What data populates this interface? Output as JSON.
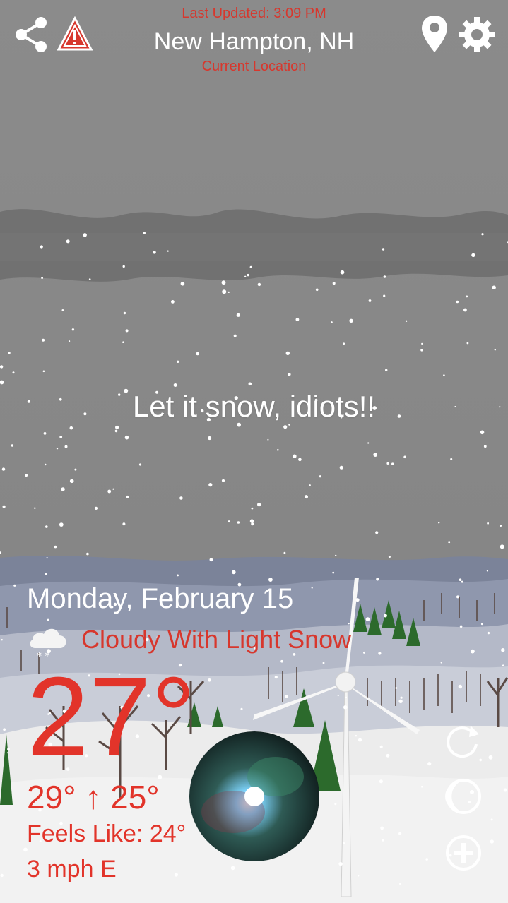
{
  "header": {
    "last_updated": "Last Updated: 3:09 PM",
    "location": "New Hampton, NH",
    "location_sub": "Current Location"
  },
  "message": "Let it snow, idiots!!",
  "weather": {
    "date": "Monday, February 15",
    "condition": "Cloudy With Light Snow",
    "temperature": "27°",
    "high_low": "29° ↑ 25°",
    "feels_like": "Feels Like: 24°",
    "wind": "3 mph E"
  },
  "icons": {
    "share": "share-icon",
    "alert": "warning-icon",
    "pin": "location-pin-icon",
    "settings": "gear-icon",
    "refresh": "refresh-icon",
    "moon": "moon-icon",
    "add": "add-icon",
    "weather": "cloud-snow-icon"
  },
  "colors": {
    "accent_red": "#e2342a",
    "sky": "#8a8a8a",
    "text_white": "#ffffff"
  }
}
